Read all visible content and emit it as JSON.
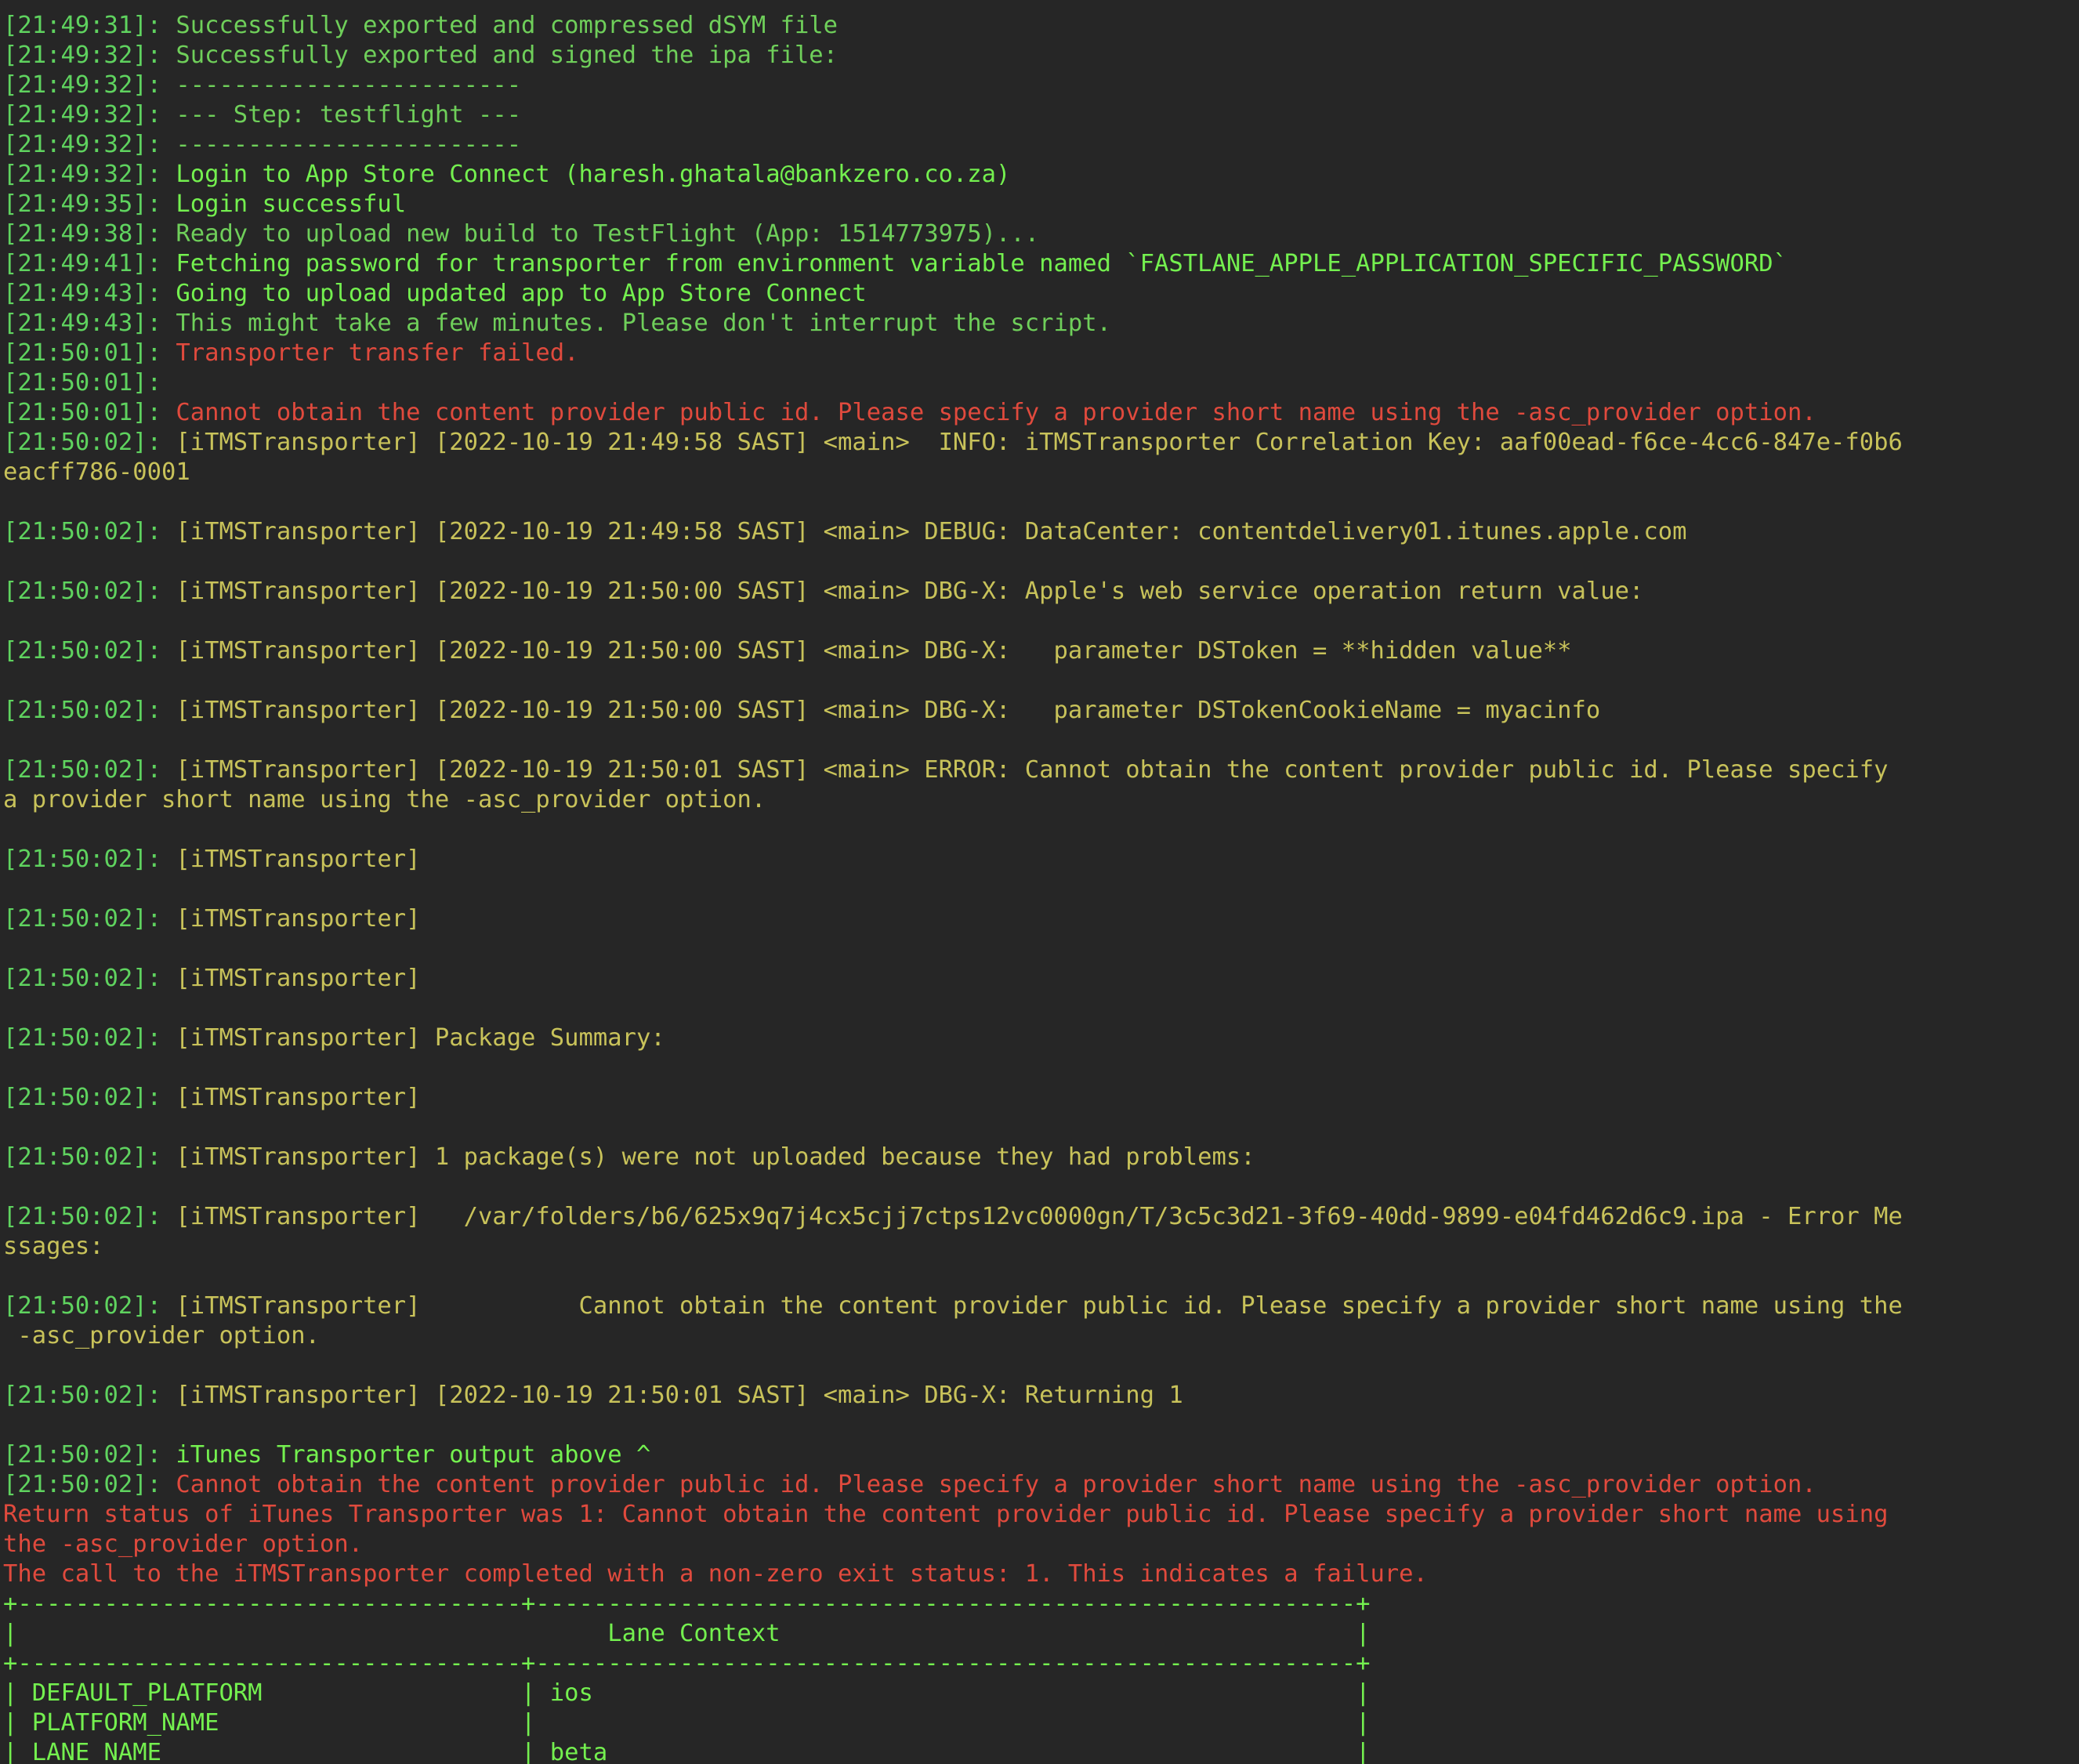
{
  "window": {
    "app": "Terminal"
  },
  "log": [
    {
      "kind": "ts",
      "time": "[21:49:31]: ",
      "text": "Successfully exported and compressed dSYM file",
      "color": "msg"
    },
    {
      "kind": "ts",
      "time": "[21:49:32]: ",
      "text": "Successfully exported and signed the ipa file:",
      "color": "msg"
    },
    {
      "kind": "ts",
      "time": "[21:49:32]: ",
      "text": "------------------------",
      "color": "msg"
    },
    {
      "kind": "ts",
      "time": "[21:49:32]: ",
      "text": "--- Step: testflight ---",
      "color": "msg"
    },
    {
      "kind": "ts",
      "time": "[21:49:32]: ",
      "text": "------------------------",
      "color": "msg"
    },
    {
      "kind": "ts",
      "time": "[21:49:32]: ",
      "text": "Login to App Store Connect (haresh.ghatala@bankzero.co.za)",
      "color": "bright"
    },
    {
      "kind": "ts",
      "time": "[21:49:35]: ",
      "text": "Login successful",
      "color": "bright"
    },
    {
      "kind": "ts",
      "time": "[21:49:38]: ",
      "text": "Ready to upload new build to TestFlight (App: 1514773975)...",
      "color": "msg"
    },
    {
      "kind": "ts",
      "time": "[21:49:41]: ",
      "text": "Fetching password for transporter from environment variable named `FASTLANE_APPLE_APPLICATION_SPECIFIC_PASSWORD`",
      "color": "bright"
    },
    {
      "kind": "ts",
      "time": "[21:49:43]: ",
      "text": "Going to upload updated app to App Store Connect",
      "color": "bright"
    },
    {
      "kind": "ts",
      "time": "[21:49:43]: ",
      "text": "This might take a few minutes. Please don't interrupt the script.",
      "color": "msg"
    },
    {
      "kind": "ts",
      "time": "[21:50:01]: ",
      "text": "Transporter transfer failed.",
      "color": "err"
    },
    {
      "kind": "ts",
      "time": "[21:50:01]: ",
      "text": "",
      "color": "err"
    },
    {
      "kind": "ts",
      "time": "[21:50:01]: ",
      "text": "Cannot obtain the content provider public id. Please specify a provider short name using the -asc_provider option.",
      "color": "err"
    },
    {
      "kind": "ts",
      "time": "[21:50:02]: ",
      "text": "[iTMSTransporter] [2022-10-19 21:49:58 SAST] <main>  INFO: iTMSTransporter Correlation Key: aaf00ead-f6ce-4cc6-847e-f0b6",
      "color": "tms"
    },
    {
      "kind": "plain",
      "time": "",
      "text": "eacff786-0001",
      "color": "tms"
    },
    {
      "kind": "blank",
      "time": "",
      "text": "",
      "color": "tms"
    },
    {
      "kind": "ts",
      "time": "[21:50:02]: ",
      "text": "[iTMSTransporter] [2022-10-19 21:49:58 SAST] <main> DEBUG: DataCenter: contentdelivery01.itunes.apple.com",
      "color": "tms"
    },
    {
      "kind": "blank",
      "time": "",
      "text": "",
      "color": "tms"
    },
    {
      "kind": "ts",
      "time": "[21:50:02]: ",
      "text": "[iTMSTransporter] [2022-10-19 21:50:00 SAST] <main> DBG-X: Apple's web service operation return value:",
      "color": "tms"
    },
    {
      "kind": "blank",
      "time": "",
      "text": "",
      "color": "tms"
    },
    {
      "kind": "ts",
      "time": "[21:50:02]: ",
      "text": "[iTMSTransporter] [2022-10-19 21:50:00 SAST] <main> DBG-X:   parameter DSToken = **hidden value**",
      "color": "tms"
    },
    {
      "kind": "blank",
      "time": "",
      "text": "",
      "color": "tms"
    },
    {
      "kind": "ts",
      "time": "[21:50:02]: ",
      "text": "[iTMSTransporter] [2022-10-19 21:50:00 SAST] <main> DBG-X:   parameter DSTokenCookieName = myacinfo",
      "color": "tms"
    },
    {
      "kind": "blank",
      "time": "",
      "text": "",
      "color": "tms"
    },
    {
      "kind": "ts",
      "time": "[21:50:02]: ",
      "text": "[iTMSTransporter] [2022-10-19 21:50:01 SAST] <main> ERROR: Cannot obtain the content provider public id. Please specify",
      "color": "tms"
    },
    {
      "kind": "plain",
      "time": "",
      "text": "a provider short name using the -asc_provider option.",
      "color": "tms"
    },
    {
      "kind": "blank",
      "time": "",
      "text": "",
      "color": "tms"
    },
    {
      "kind": "ts",
      "time": "[21:50:02]: ",
      "text": "[iTMSTransporter]",
      "color": "tms"
    },
    {
      "kind": "blank",
      "time": "",
      "text": "",
      "color": "tms"
    },
    {
      "kind": "ts",
      "time": "[21:50:02]: ",
      "text": "[iTMSTransporter]",
      "color": "tms"
    },
    {
      "kind": "blank",
      "time": "",
      "text": "",
      "color": "tms"
    },
    {
      "kind": "ts",
      "time": "[21:50:02]: ",
      "text": "[iTMSTransporter]",
      "color": "tms"
    },
    {
      "kind": "blank",
      "time": "",
      "text": "",
      "color": "tms"
    },
    {
      "kind": "ts",
      "time": "[21:50:02]: ",
      "text": "[iTMSTransporter] Package Summary:",
      "color": "tms"
    },
    {
      "kind": "blank",
      "time": "",
      "text": "",
      "color": "tms"
    },
    {
      "kind": "ts",
      "time": "[21:50:02]: ",
      "text": "[iTMSTransporter]",
      "color": "tms"
    },
    {
      "kind": "blank",
      "time": "",
      "text": "",
      "color": "tms"
    },
    {
      "kind": "ts",
      "time": "[21:50:02]: ",
      "text": "[iTMSTransporter] 1 package(s) were not uploaded because they had problems:",
      "color": "tms"
    },
    {
      "kind": "blank",
      "time": "",
      "text": "",
      "color": "tms"
    },
    {
      "kind": "ts",
      "time": "[21:50:02]: ",
      "text": "[iTMSTransporter]   /var/folders/b6/625x9q7j4cx5cjj7ctps12vc0000gn/T/3c5c3d21-3f69-40dd-9899-e04fd462d6c9.ipa - Error Me",
      "color": "tms"
    },
    {
      "kind": "plain",
      "time": "",
      "text": "ssages:",
      "color": "tms"
    },
    {
      "kind": "blank",
      "time": "",
      "text": "",
      "color": "tms"
    },
    {
      "kind": "ts",
      "time": "[21:50:02]: ",
      "text": "[iTMSTransporter]           Cannot obtain the content provider public id. Please specify a provider short name using the",
      "color": "tms"
    },
    {
      "kind": "plain",
      "time": "",
      "text": " -asc_provider option.",
      "color": "tms"
    },
    {
      "kind": "blank",
      "time": "",
      "text": "",
      "color": "tms"
    },
    {
      "kind": "ts",
      "time": "[21:50:02]: ",
      "text": "[iTMSTransporter] [2022-10-19 21:50:01 SAST] <main> DBG-X: Returning 1",
      "color": "tms"
    },
    {
      "kind": "blank",
      "time": "",
      "text": "",
      "color": "tms"
    },
    {
      "kind": "ts",
      "time": "[21:50:02]: ",
      "text": "iTunes Transporter output above ^",
      "color": "bright"
    },
    {
      "kind": "ts",
      "time": "[21:50:02]: ",
      "text": "Cannot obtain the content provider public id. Please specify a provider short name using the -asc_provider option.",
      "color": "err"
    },
    {
      "kind": "plain",
      "time": "",
      "text": "Return status of iTunes Transporter was 1: Cannot obtain the content provider public id. Please specify a provider short name using",
      "color": "err"
    },
    {
      "kind": "plain",
      "time": "",
      "text": "the -asc_provider option.",
      "color": "err"
    },
    {
      "kind": "plain",
      "time": "",
      "text": "The call to the iTMSTransporter completed with a non-zero exit status: 1. This indicates a failure.",
      "color": "err"
    },
    {
      "kind": "plain",
      "time": "",
      "text": "+-----------------------------------+---------------------------------------------------------+",
      "color": "table"
    },
    {
      "kind": "plain",
      "time": "",
      "text": "|                                         Lane Context                                        |",
      "color": "table"
    },
    {
      "kind": "plain",
      "time": "",
      "text": "+-----------------------------------+---------------------------------------------------------+",
      "color": "table"
    },
    {
      "kind": "plain",
      "time": "",
      "text": "| DEFAULT_PLATFORM                  | ios                                                     |",
      "color": "table"
    },
    {
      "kind": "plain",
      "time": "",
      "text": "| PLATFORM_NAME                     |                                                         |",
      "color": "table"
    },
    {
      "kind": "plain",
      "time": "",
      "text": "| LANE_NAME                         | beta                                                    |",
      "color": "table"
    }
  ],
  "colors": {
    "background": "#262626",
    "timestamp": "#5fd35f",
    "message": "#6fcf5a",
    "bright": "#74f04f",
    "error": "#e04a3d",
    "transporter": "#c8c25a"
  }
}
